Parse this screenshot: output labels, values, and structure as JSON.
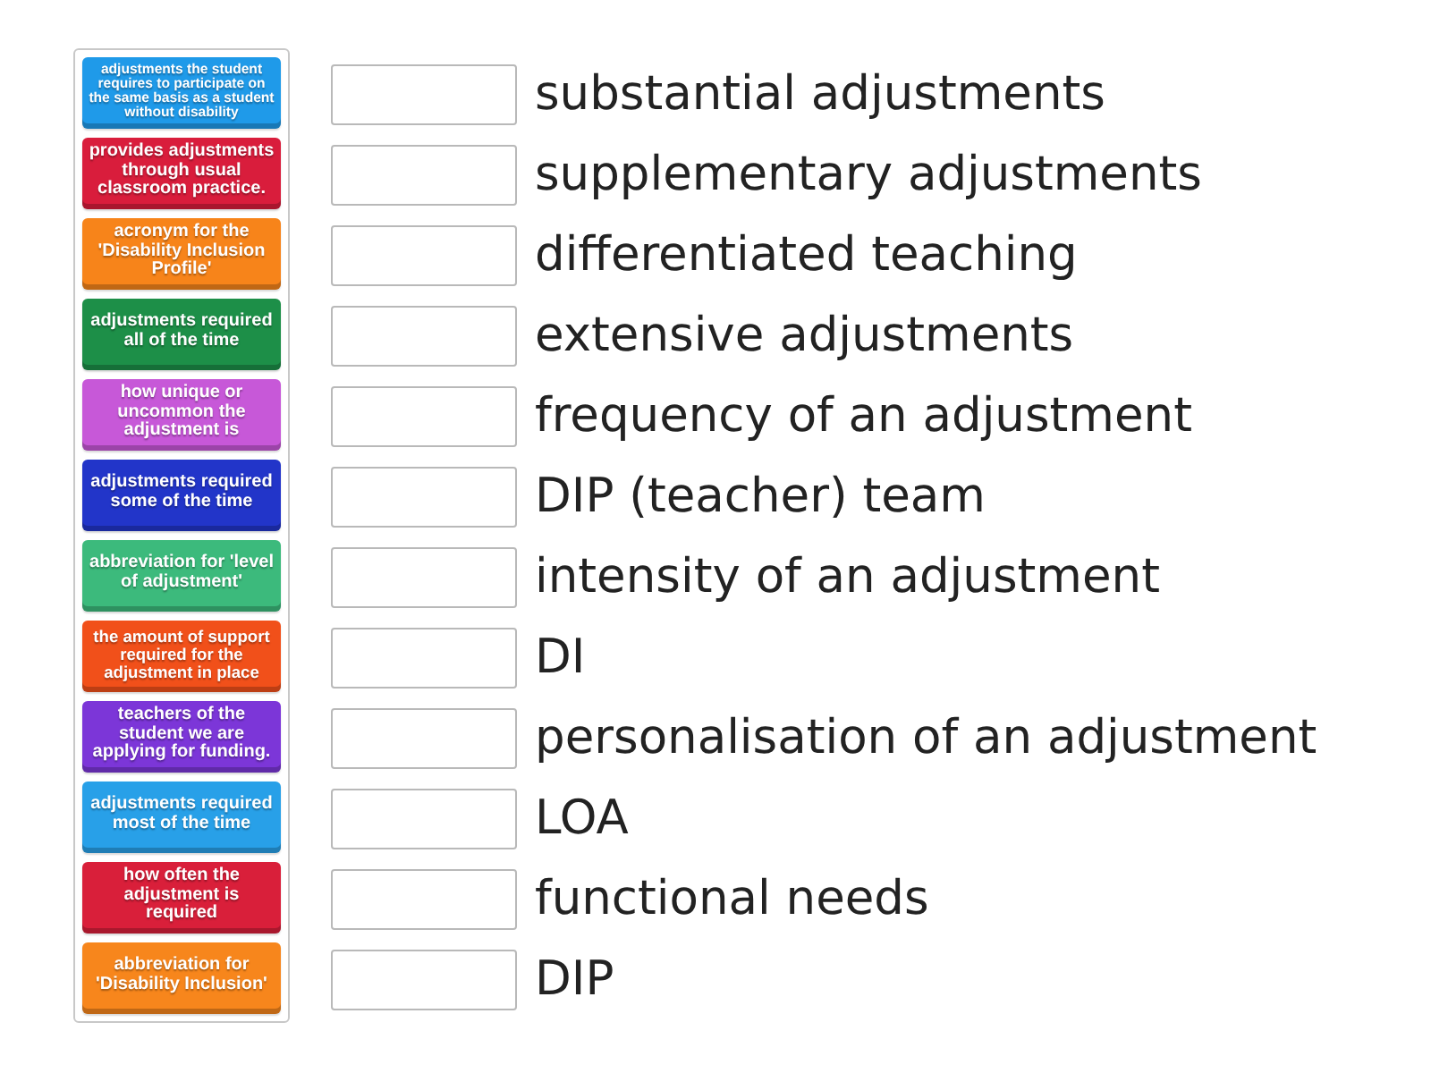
{
  "tiles": [
    {
      "text": "adjustments the student requires to participate on the same basis as a student without disability",
      "color": "#1f9ae9"
    },
    {
      "text": "provides adjustments through usual classroom practice.",
      "color": "#d91d3c"
    },
    {
      "text": "acronym for the 'Disability Inclusion Profile'",
      "color": "#f7841a"
    },
    {
      "text": "adjustments required all of the time",
      "color": "#1d8f48"
    },
    {
      "text": "how unique or uncommon the adjustment is",
      "color": "#c758d8"
    },
    {
      "text": "adjustments required some of the time",
      "color": "#2235c9"
    },
    {
      "text": "abbreviation for 'level of adjustment'",
      "color": "#3cba7c"
    },
    {
      "text": "the amount of support required for the adjustment in place",
      "color": "#f1501a"
    },
    {
      "text": "teachers of the student we are applying for funding.",
      "color": "#7c36d8"
    },
    {
      "text": "adjustments required most of the time",
      "color": "#28a0e8"
    },
    {
      "text": "how often the adjustment is required",
      "color": "#d91f3a"
    },
    {
      "text": "abbreviation for 'Disability Inclusion'",
      "color": "#f7861c"
    }
  ],
  "targets": [
    {
      "label": "substantial adjustments"
    },
    {
      "label": "supplementary adjustments"
    },
    {
      "label": "differentiated teaching"
    },
    {
      "label": "extensive adjustments"
    },
    {
      "label": "frequency of an adjustment"
    },
    {
      "label": "DIP (teacher) team"
    },
    {
      "label": "intensity of an adjustment"
    },
    {
      "label": "DI"
    },
    {
      "label": "personalisation of an adjustment"
    },
    {
      "label": "LOA"
    },
    {
      "label": "functional needs"
    },
    {
      "label": "DIP"
    }
  ]
}
